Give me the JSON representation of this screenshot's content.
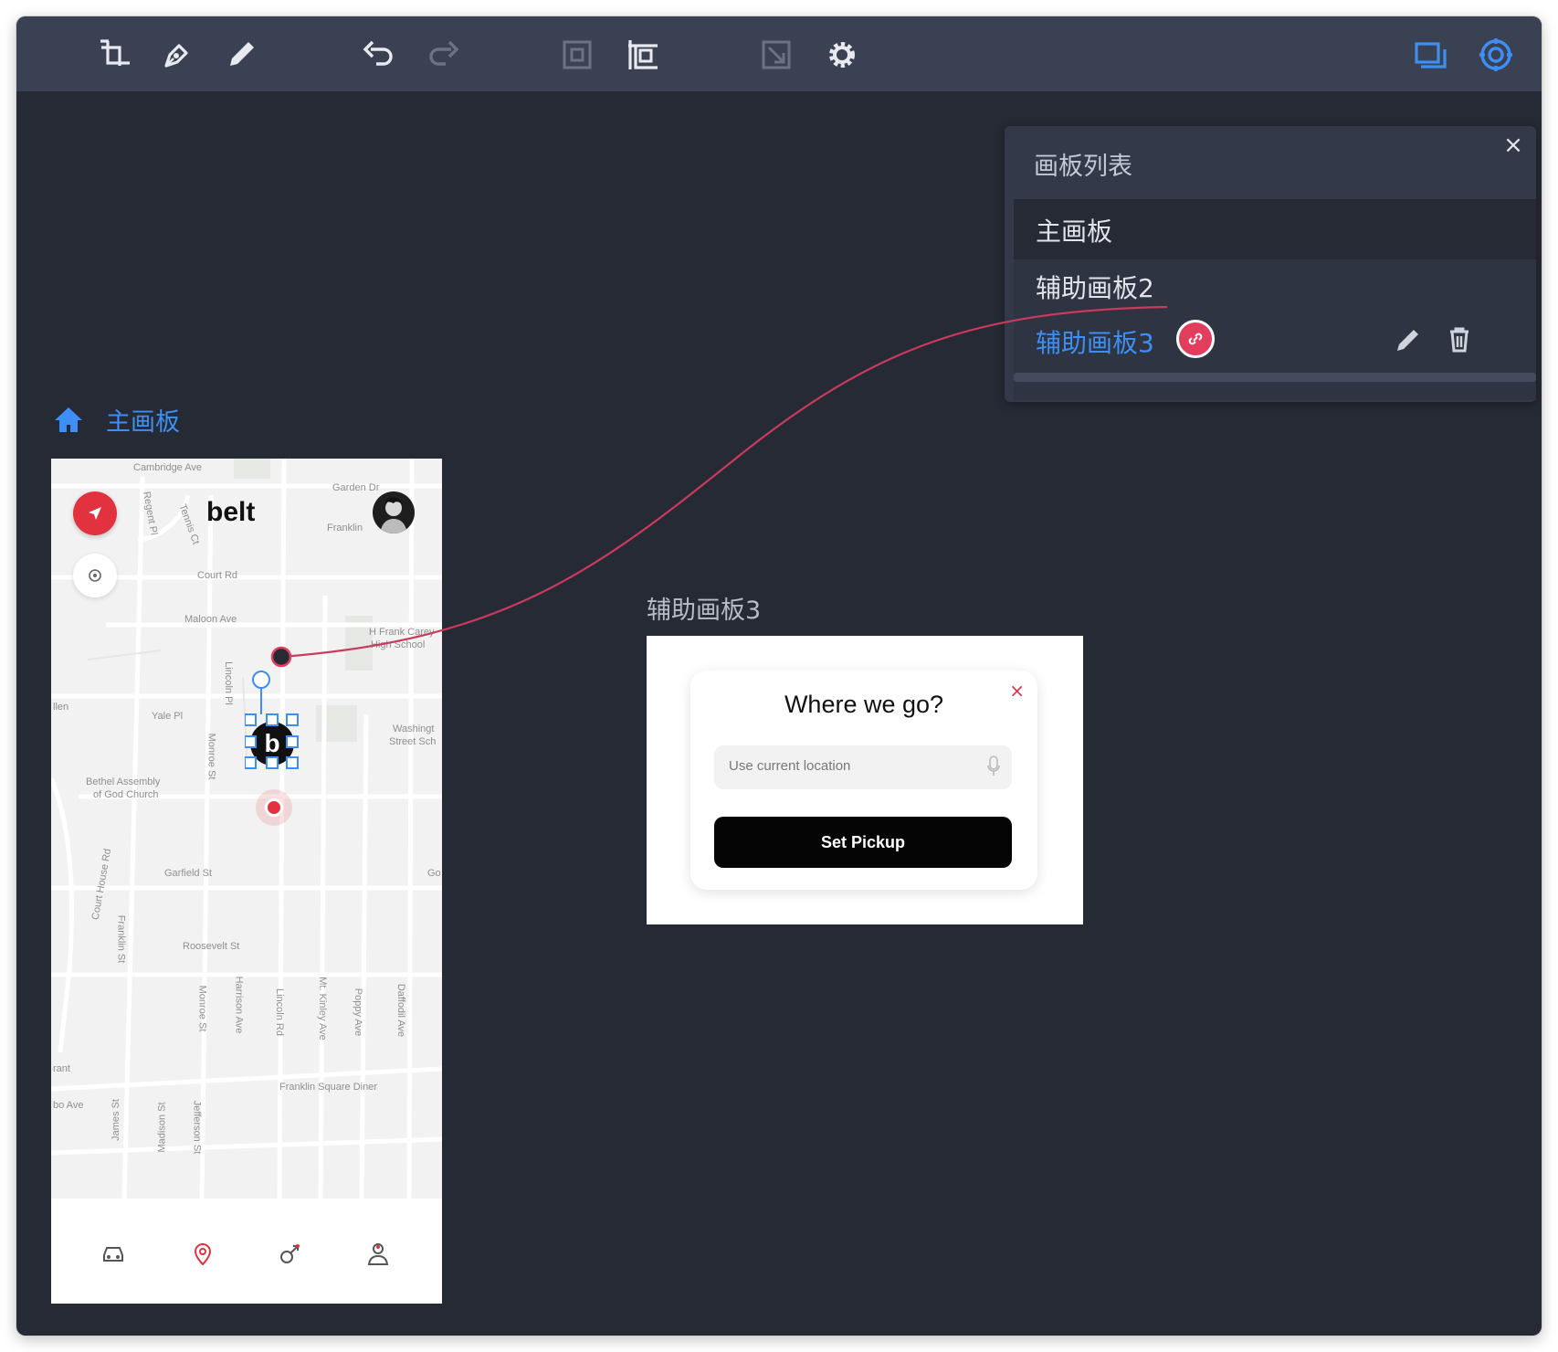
{
  "toolbar": {
    "items": [
      "crop-icon",
      "pen-icon",
      "pencil-icon",
      "undo-icon",
      "redo-icon",
      "frame-icon",
      "layout-icon",
      "resize-icon",
      "settings-icon",
      "screens-icon",
      "target-icon"
    ]
  },
  "artboard_panel": {
    "title": "画板列表",
    "close": "×",
    "items": [
      {
        "label": "主画板"
      },
      {
        "label": "辅助画板2"
      },
      {
        "label": "辅助画板3"
      }
    ]
  },
  "main_artboard": {
    "label": "主画板",
    "app": {
      "brand": "belt",
      "streets": [
        "Cambridge Ave",
        "Garden Dr",
        "Franklin",
        "Regent Pl",
        "Tennis Ct",
        "Court Rd",
        "Maloon Ave",
        "H Frank Carey",
        "High School",
        "Lincoln Pl",
        "Yale Pl",
        "Monroe St",
        "Washingt",
        "Street Sch",
        "Bethel Assembly",
        "of God Church",
        "Garfield St",
        "Court House Rd",
        "Franklin St",
        "Roosevelt St",
        "Monroe St",
        "Harrison Ave",
        "Lincoln Rd",
        "Mt. Kinley Ave",
        "Poppy Ave",
        "Daffodil Ave",
        "Franklin Square Diner",
        "James St",
        "Madison St",
        "Jefferson St",
        "Rd",
        "llen",
        "rant",
        "bo Ave",
        "Go"
      ],
      "tabs": [
        "car-icon",
        "location-pin-icon",
        "gender-icon",
        "user-icon"
      ]
    }
  },
  "aux_artboard": {
    "label": "辅助画板3",
    "card": {
      "title": "Where we go?",
      "close": "×",
      "input_placeholder": "Use current location",
      "button": "Set Pickup"
    }
  },
  "colors": {
    "canvas": "#262a35",
    "toolbar": "#3a4152",
    "accent_blue": "#3d8ff5",
    "link_red": "#e23d5c",
    "pin_red": "#e3323f"
  }
}
